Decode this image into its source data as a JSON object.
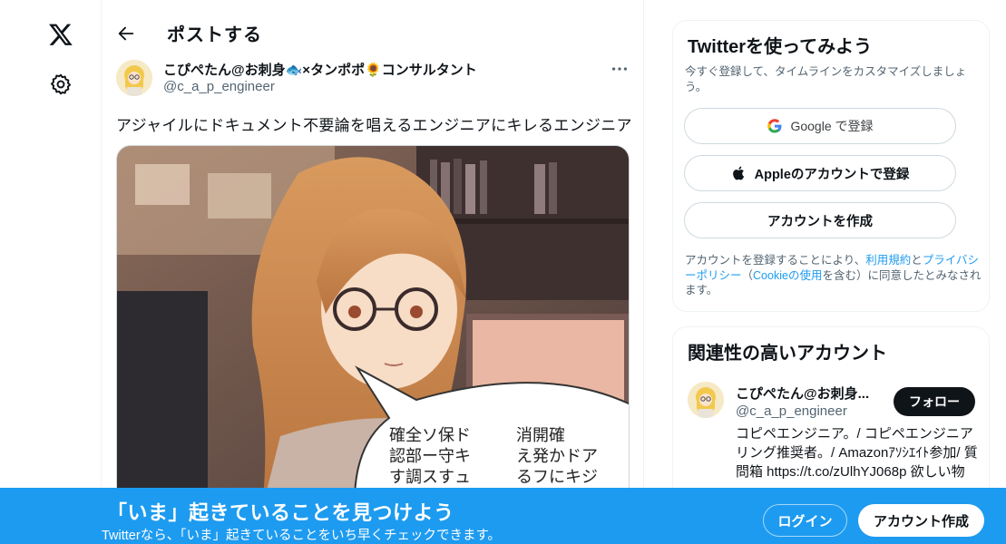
{
  "nav": {
    "logo_icon": "x-logo-icon",
    "settings_icon": "gear-icon"
  },
  "header": {
    "title": "ポストする",
    "back_icon": "arrow-left-icon"
  },
  "post": {
    "author_name": "こぴぺたん@お刺身🐟×タンポポ🌻コンサルタント",
    "author_handle": "@c_a_p_engineer",
    "more_icon": "ellipsis-icon",
    "text": "アジャイルにドキュメント不要論を唱えるエンジニアにキレるエンジニア",
    "media_speech_lines": [
      "確全ソ保ド",
      "認部ー守キ",
      "す調スすュ",
      "消開確",
      "え発かドア",
      "るフにキジ"
    ]
  },
  "signup_card": {
    "title": "Twitterを使ってみよう",
    "subtitle": "今すぐ登録して、タイムラインをカスタマイズしましょう。",
    "google_label": "Google で登録",
    "apple_label": "Appleのアカウントで登録",
    "create_label": "アカウントを作成",
    "legal_prefix": "アカウントを登録することにより、",
    "terms_link": "利用規約",
    "legal_and": "と",
    "privacy_link": "プライバシーポリシー",
    "legal_paren_open": "（",
    "cookie_link": "Cookieの使用",
    "legal_suffix": "を含む）に同意したとみなされます。"
  },
  "related_card": {
    "title": "関連性の高いアカウント",
    "account_name": "こぴぺたん@お刺身...",
    "account_handle": "@c_a_p_engineer",
    "follow_label": "フォロー",
    "bio": "コピペエンジニア。/ コピペエンジニアリング推奨者。/ Amazonｱｿｼｴｲﾄ参加/ 質問箱 https://t.co/zUlhYJ068p 欲しい物"
  },
  "banner": {
    "title": "「いま」起きていることを見つけよう",
    "description": "Twitterなら、「いま」起きていることをいち早くチェックできます。",
    "login_label": "ログイン",
    "signup_label": "アカウント作成"
  },
  "colors": {
    "accent": "#1d9bf0",
    "text": "#0f1419",
    "secondary": "#536471"
  }
}
